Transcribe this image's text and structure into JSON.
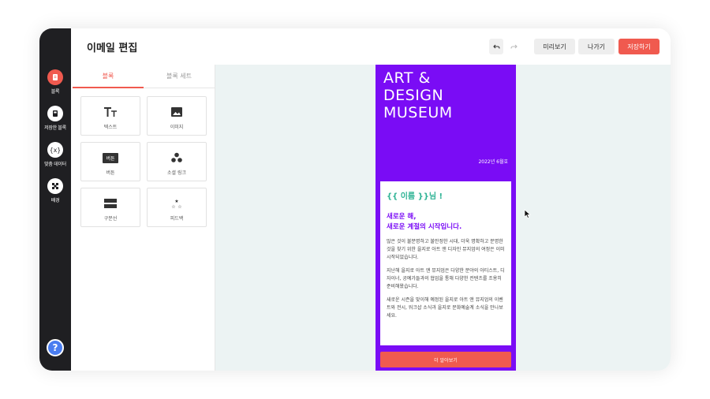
{
  "header": {
    "title": "이메일 편집",
    "preview": "미리보기",
    "exit": "나가기",
    "save": "저장하기"
  },
  "rail": {
    "items": [
      {
        "label": "블록",
        "icon": "block-icon"
      },
      {
        "label": "저장한 블록",
        "icon": "saved-block-icon"
      },
      {
        "label": "맞춤 데이터",
        "icon": "custom-data-icon"
      },
      {
        "label": "배경",
        "icon": "background-icon"
      }
    ],
    "help": "?"
  },
  "panel": {
    "tabs": [
      "블록",
      "블록 세트"
    ],
    "blocks": [
      {
        "label": "텍스트",
        "icon": "text-icon"
      },
      {
        "label": "이미지",
        "icon": "image-icon"
      },
      {
        "label": "버튼",
        "icon": "button-icon",
        "icon_text": "버튼"
      },
      {
        "label": "소셜 링크",
        "icon": "social-icon"
      },
      {
        "label": "구분선",
        "icon": "divider-icon"
      },
      {
        "label": "피드백",
        "icon": "feedback-icon"
      }
    ]
  },
  "email": {
    "hero": [
      "ART &",
      "DESIGN",
      "MUSEUM"
    ],
    "date": "2022년 6월호",
    "greeting": "{{ 이름 }}님 !",
    "heading": [
      "새로운 해,",
      "새로운 계절의 시작입니다."
    ],
    "paragraphs": [
      "많은 것이 불분명하고 불안정한 시대, 더욱 명확하고 분명한 것을 찾기 위한 을지로 아트 앤 디자인 뮤지엄의 여정은 이미 시작되었습니다.",
      "지난해 을지로 아트 앤 뮤지엄은 다양한 분야의 아티스트, 디자이너, 공예가들과의 협업을 통해 다양한 컨텐츠를 조용히 준비해왔습니다.",
      "새로운 시즌을 맞이해 예정된 을지로 아트 앤 뮤지엄의 이벤트와 전시, 워크샵 소식과 을지로 문화예술계 소식을 만나보세요."
    ],
    "cta": "더 알아보기"
  },
  "colors": {
    "accent": "#f05a4f",
    "email_bg": "#7a0cf5",
    "greeting": "#2fb395",
    "rail": "#1f1f22"
  }
}
